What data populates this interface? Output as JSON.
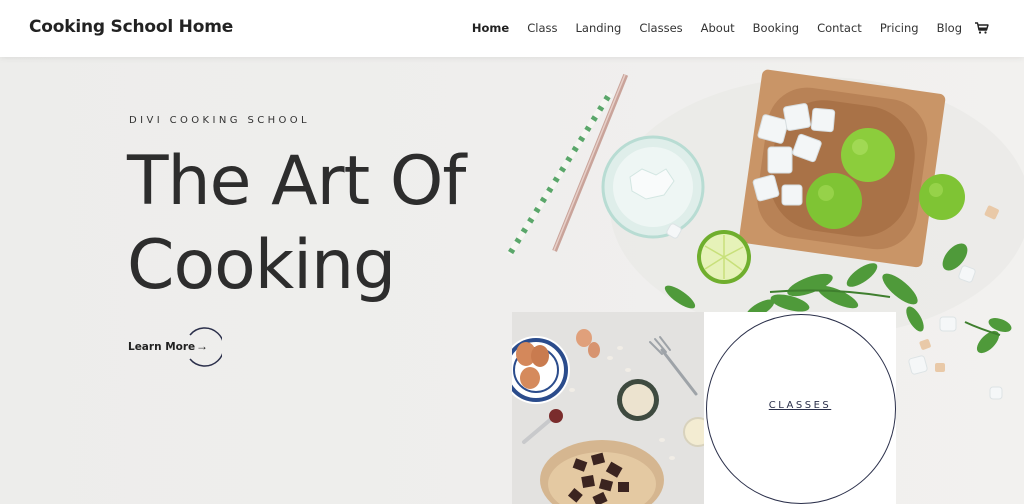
{
  "header": {
    "logo": "Cooking School Home",
    "nav": [
      "Home",
      "Class",
      "Landing",
      "Classes",
      "About",
      "Booking",
      "Contact",
      "Pricing",
      "Blog"
    ],
    "active_nav": "Home",
    "cart_icon": "cart-icon"
  },
  "hero": {
    "eyebrow": "DIVI COOKING SCHOOL",
    "title_line1": "The Art Of",
    "title_line2": "Cooking",
    "cta_label": "Learn More",
    "cta_arrow": "→"
  },
  "tiles": {
    "classes_label": "CLASSES"
  },
  "colors": {
    "accent_navy": "#2a2f4a",
    "background": "#efeeec",
    "text": "#2d2d2d"
  }
}
